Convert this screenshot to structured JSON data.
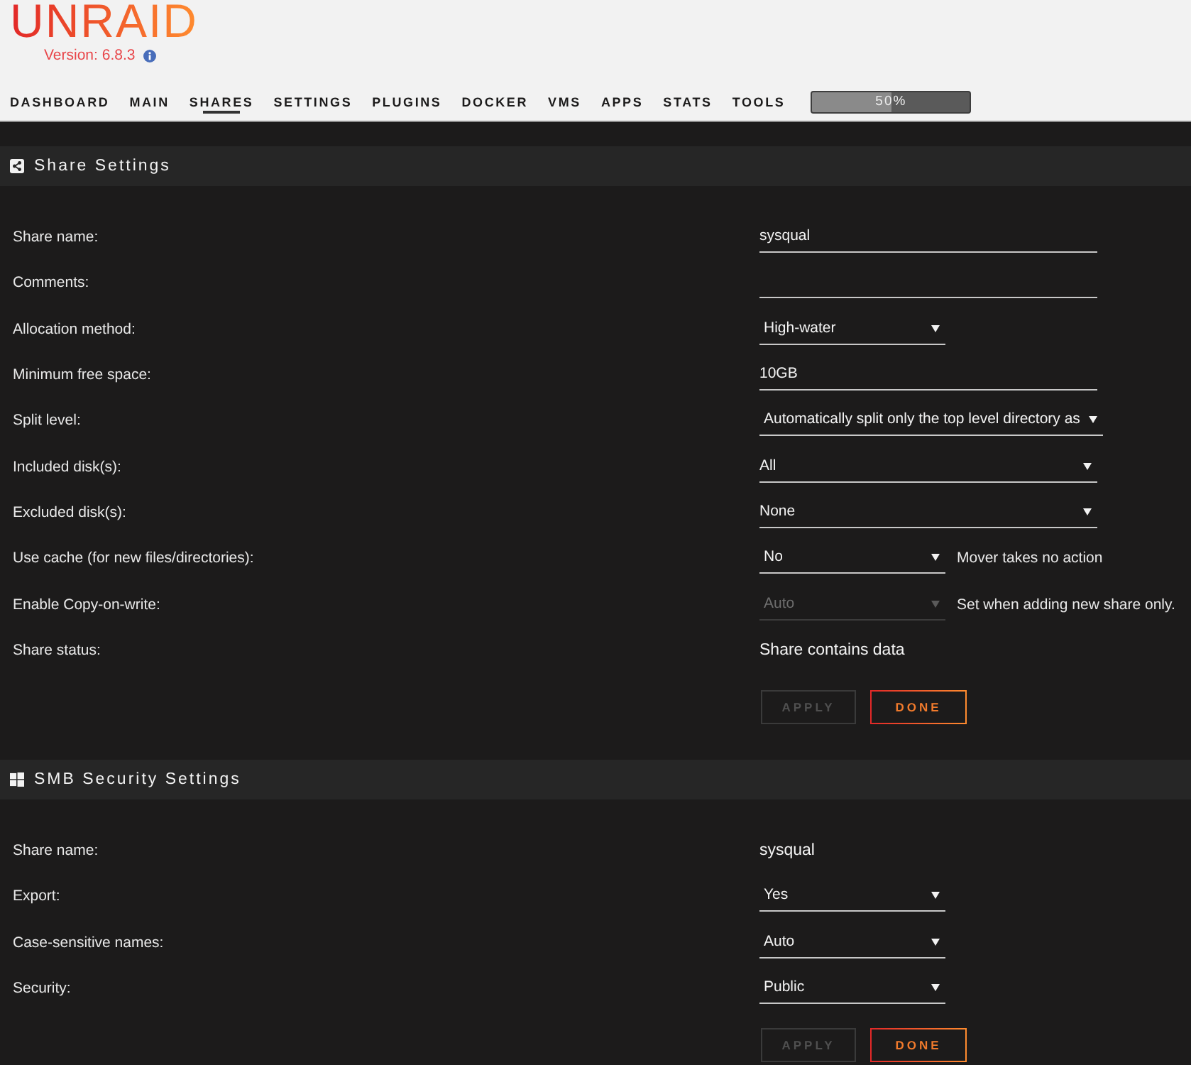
{
  "header": {
    "logo": "UNRAID",
    "version": "Version: 6.8.3"
  },
  "nav": {
    "tabs": [
      {
        "label": "DASHBOARD",
        "selected": false
      },
      {
        "label": "MAIN",
        "selected": false
      },
      {
        "label": "SHARES",
        "selected": true
      },
      {
        "label": "SETTINGS",
        "selected": false
      },
      {
        "label": "PLUGINS",
        "selected": false
      },
      {
        "label": "DOCKER",
        "selected": false
      },
      {
        "label": "VMS",
        "selected": false
      },
      {
        "label": "APPS",
        "selected": false
      },
      {
        "label": "STATS",
        "selected": false
      },
      {
        "label": "TOOLS",
        "selected": false
      }
    ],
    "progress": {
      "label": "50%",
      "level": 0.5
    }
  },
  "sections": [
    {
      "title": "Share Settings",
      "rows": [
        {
          "label": "Share name:",
          "kind": "input",
          "value": "sysqual",
          "disabled": false
        },
        {
          "label": "Comments:",
          "kind": "input",
          "disabled": false
        },
        {
          "label": "Allocation method:",
          "kind": "select",
          "value": "High-water",
          "disabled": false
        },
        {
          "label": "Minimum free space:",
          "kind": "input",
          "value": "10GB",
          "disabled": false
        },
        {
          "label": "Split level:",
          "kind": "wideselect",
          "value": "Automatically split only the top level directory as",
          "disabled": false
        },
        {
          "label": "Included disk(s):",
          "kind": "multiselect",
          "value": "All",
          "disabled": false
        },
        {
          "label": "Excluded disk(s):",
          "kind": "multiselect",
          "value": "None",
          "disabled": false
        },
        {
          "label": "Use cache (for new files/directories):",
          "kind": "select",
          "value": "No",
          "note": "Mover takes no action",
          "disabled": false
        },
        {
          "label": "Enable Copy-on-write:",
          "kind": "select",
          "value": "Auto",
          "note": "Set when adding new share only.",
          "disabled": true
        },
        {
          "label": "Share status:",
          "kind": "static",
          "value": "Share contains data"
        }
      ],
      "buttons": [
        {
          "label": "APPLY",
          "disabled": true
        },
        {
          "label": "DONE",
          "disabled": false
        }
      ]
    },
    {
      "title": "SMB Security Settings",
      "rows": [
        {
          "label": "Share name:",
          "kind": "static",
          "value": "sysqual"
        },
        {
          "label": "Export:",
          "kind": "select",
          "value": "Yes",
          "disabled": false
        },
        {
          "label": "Case-sensitive names:",
          "kind": "select",
          "value": "Auto",
          "disabled": false
        },
        {
          "label": "Security:",
          "kind": "select",
          "value": "Public",
          "disabled": false
        }
      ],
      "buttons": [
        {
          "label": "APPLY",
          "disabled": true
        },
        {
          "label": "DONE",
          "disabled": false
        }
      ]
    }
  ]
}
